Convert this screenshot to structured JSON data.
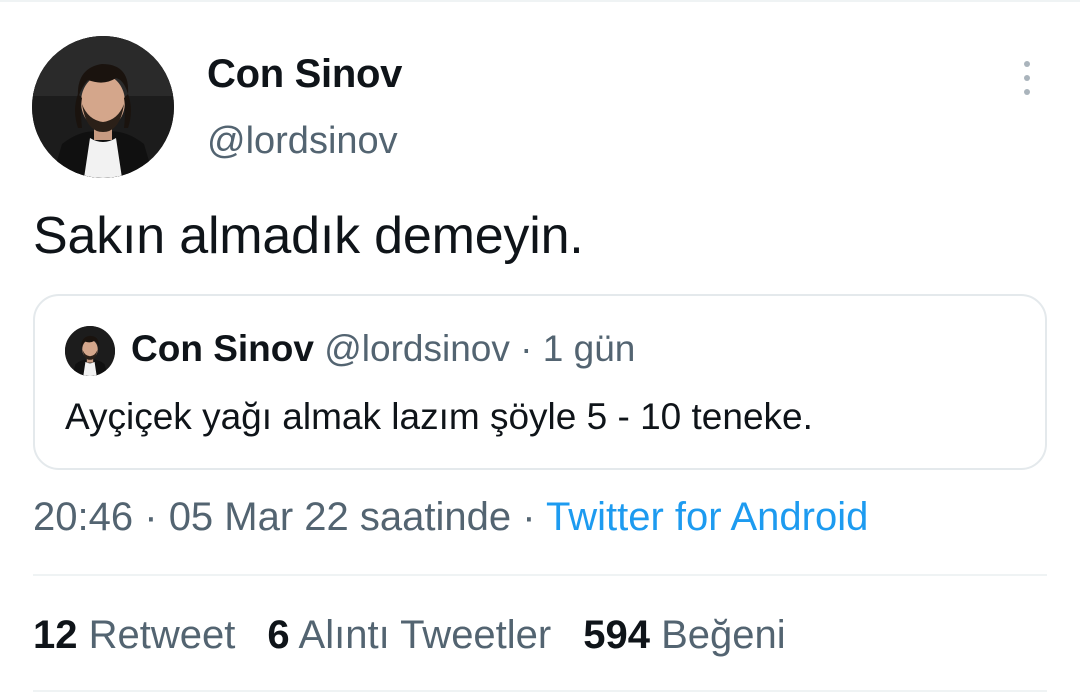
{
  "tweet": {
    "author": {
      "display_name": "Con Sinov",
      "username": "@lordsinov"
    },
    "text": "Sakın almadık demeyin.",
    "quoted_tweet": {
      "display_name": "Con Sinov",
      "username": "@lordsinov",
      "separator": "·",
      "time_ago": "1 gün",
      "text": "Ayçiçek yağı almak lazım şöyle 5 - 10 teneke."
    },
    "timestamp": {
      "time": "20:46",
      "separator": "·",
      "date": "05 Mar 22 saatinde",
      "source_separator": "·",
      "source": "Twitter for Android"
    },
    "stats": [
      {
        "count": "12",
        "label": "Retweet"
      },
      {
        "count": "6",
        "label": "Alıntı Tweetler"
      },
      {
        "count": "594",
        "label": "Beğeni"
      }
    ]
  },
  "colors": {
    "text_primary": "#0f1419",
    "text_secondary": "#536471",
    "link": "#1d9bf0",
    "border": "#e4e9ec"
  },
  "icons": {
    "more": "more-vertical-icon"
  }
}
